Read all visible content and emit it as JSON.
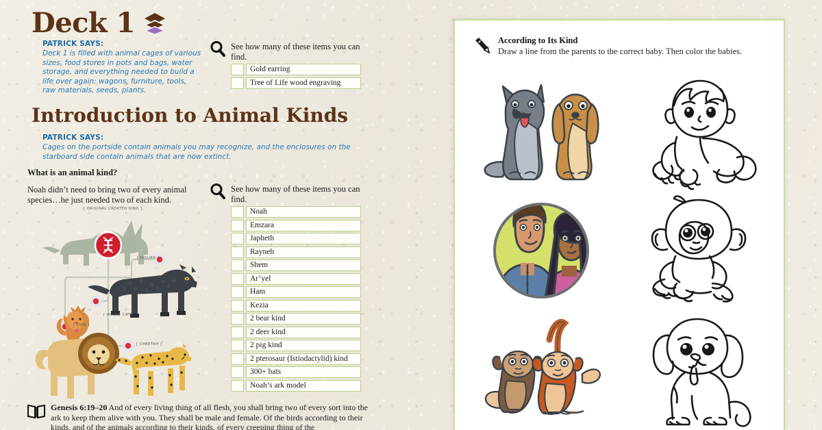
{
  "page": {
    "background_color": "#efebe0",
    "accent_brown": "#5c3317",
    "accent_blue": "#1b6ca8",
    "accent_green": "#b5d08a"
  },
  "deck": {
    "title": "Deck 1",
    "icon": "layers-stack-icon",
    "patrick_label": "PATRICK SAYS:",
    "patrick_text": "Deck 1 is filled with animal cages of various sizes, food stores in pots and bags, water storage, and everything needed to build a life over again: wagons, furniture, tools, raw materials, seeds, plants."
  },
  "find_deck": {
    "icon": "magnifier-icon",
    "prompt": "See how many of these items you can find.",
    "items": [
      "Gold earring",
      "Tree of Life wood engraving"
    ]
  },
  "intro_section": {
    "heading": "Introduction to Animal Kinds",
    "patrick_label": "PATRICK SAYS:",
    "patrick_text": "Cages on the portside contain animals you may recognize, and the enclosures on the starboard side contain animals that are now extinct.",
    "question": "What is an animal kind?",
    "paragraph": "Noah didn’t need to bring two of every animal species…he just needed two of each kind."
  },
  "find_intro": {
    "icon": "magnifier-icon",
    "prompt": "See how many of these items you can find.",
    "items": [
      "Noah",
      "Emzara",
      "Japheth",
      "Rayneh",
      "Shem",
      "Ar’yel",
      "Ham",
      "Kezia",
      "2 bear kind",
      "2 deer kind",
      "2 pig kind",
      "2 pterosaur (Istiodactylid) kind",
      "300+ bats",
      "Noah’s ark model"
    ]
  },
  "kind_diagram": {
    "root_label": "[ ORIGINAL CREATED KIND ]",
    "root_icon": "dna-badge-icon",
    "nodes": [
      {
        "label": "[ HOUSE CAT ]",
        "icon": "house-cat-illustration"
      },
      {
        "label": "[ JAGUAR ]",
        "icon": "black-jaguar-illustration"
      },
      {
        "label": "[ LION ]",
        "icon": "lion-illustration"
      },
      {
        "label": "[ CHEETAH ]",
        "icon": "cheetah-illustration"
      }
    ]
  },
  "scripture": {
    "icon": "open-book-icon",
    "reference": "Genesis 6:19–20",
    "text": " And of every living thing of all flesh, you shall bring two of every sort into the ark to keep them alive with you. They shall be male and female. Of the birds according to their kinds, and of the animals according to their kinds, of every creeping thing of the"
  },
  "worksheet": {
    "icon": "pencil-icon",
    "title": "According to Its Kind",
    "instructions": "Draw a line from the parents to the correct baby. Then color the babies.",
    "rows": [
      {
        "parents": "wolf-and-dog-illustration",
        "baby": "baby-human-outline"
      },
      {
        "parents": "human-couple-portrait",
        "baby": "baby-monkey-outline"
      },
      {
        "parents": "two-monkeys-illustration",
        "baby": "puppy-outline"
      }
    ]
  }
}
